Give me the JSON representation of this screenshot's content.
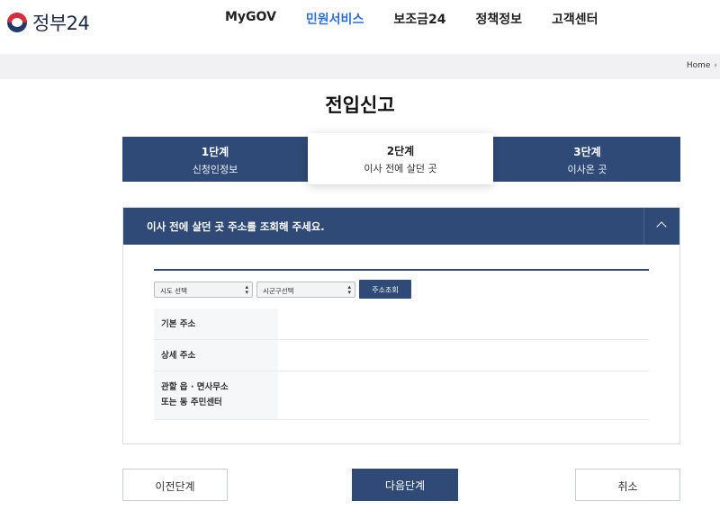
{
  "header": {
    "logo_text": "정부24",
    "nav": [
      "MyGOV",
      "민원서비스",
      "보조금24",
      "정책정보",
      "고객센터"
    ],
    "active_nav_index": 1
  },
  "breadcrumb": {
    "home": "Home",
    "arrow": "›"
  },
  "page_title": "전입신고",
  "steps": [
    {
      "title": "1단계",
      "subtitle": "신청인정보"
    },
    {
      "title": "2단계",
      "subtitle": "이사 전에 살던 곳"
    },
    {
      "title": "3단계",
      "subtitle": "이사온 곳"
    }
  ],
  "current_step": 2,
  "panel": {
    "heading": "이사 전에 살던 곳 주소를 조회해 주세요.",
    "toggle_icon": "chevron-up-icon",
    "sido_select": "시도 선택",
    "sigungu_select": "시군구선택",
    "search_button": "주소조회",
    "rows": {
      "basic_address": "기본 주소",
      "detail_address": "상세 주소",
      "office_line1": "관할 읍 · 면사무소",
      "office_line2": "또는 동 주민센터"
    }
  },
  "buttons": {
    "prev": "이전단계",
    "next": "다음단계",
    "cancel": "취소"
  },
  "colors": {
    "primary": "#2f4a76",
    "active_nav": "#2f6fd6",
    "crumb_bg": "#f1f1f3"
  }
}
